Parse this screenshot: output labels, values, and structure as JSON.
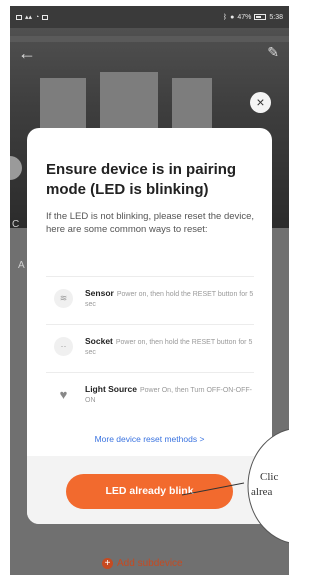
{
  "status_bar": {
    "time": "5:38",
    "battery": "47%"
  },
  "modal": {
    "title": "Ensure device is in pairing mode (LED is blinking)",
    "description": "If the LED is not blinking, please reset the device, here are some common ways to reset:",
    "methods": [
      {
        "name": "Sensor",
        "detail": "Power on, then hold the RESET button for 5 sec",
        "icon": "sensor-icon"
      },
      {
        "name": "Socket",
        "detail": "Power on, then hold the RESET button for 5 sec",
        "icon": "socket-icon"
      },
      {
        "name": "Light Source",
        "detail": "Power On, then Turn OFF-ON-OFF-ON",
        "icon": "bulb-icon"
      }
    ],
    "more_link": "More device reset methods >",
    "confirm_button": "LED already blink"
  },
  "footer": {
    "add_subdevice": "Add subdevice"
  },
  "callout": {
    "line1": "Clic",
    "line2": "alrea"
  },
  "colors": {
    "accent": "#f26a2e",
    "link": "#3a73e0",
    "overlay": "#6d6d6d"
  }
}
